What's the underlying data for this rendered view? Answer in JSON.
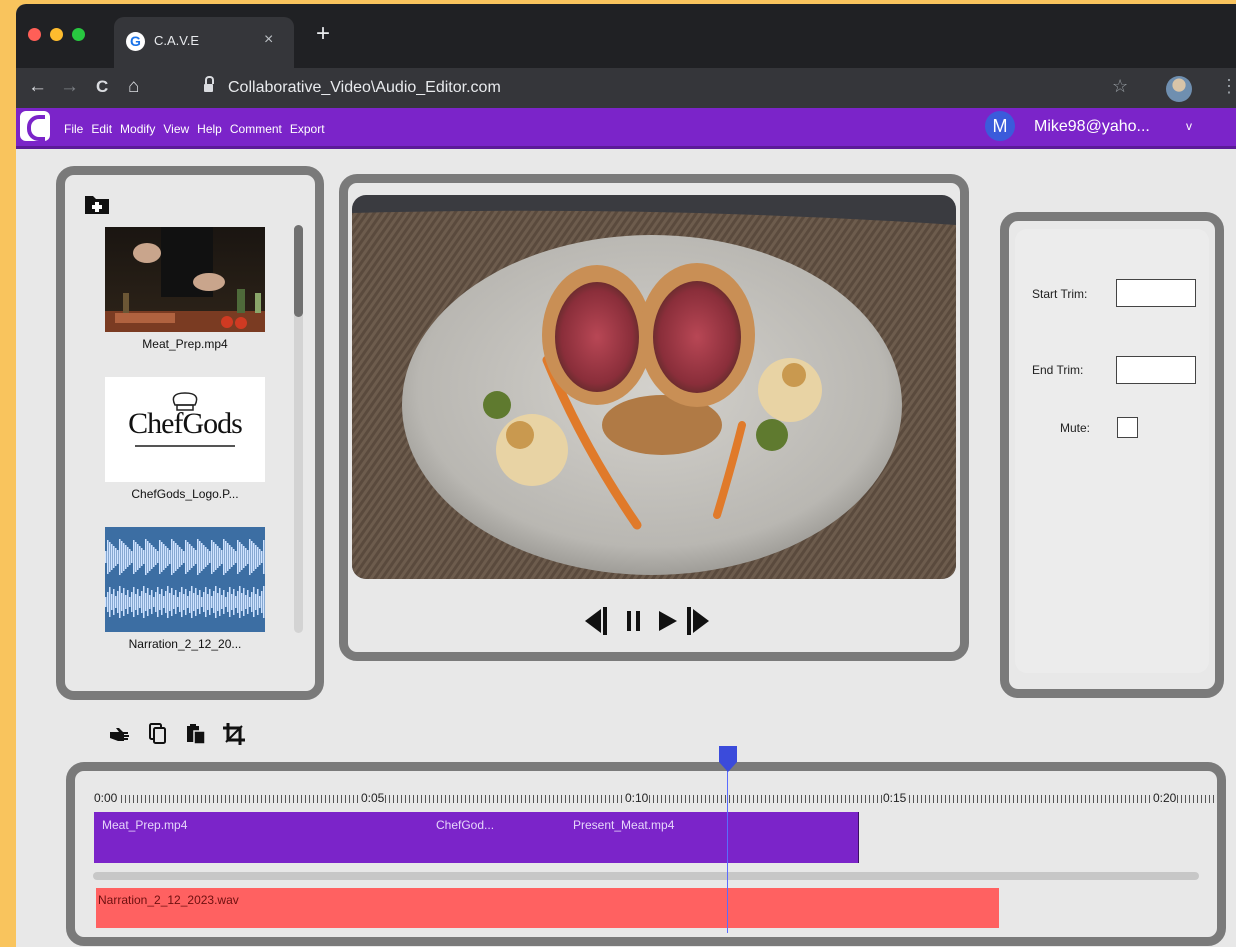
{
  "browser": {
    "tab_title": "C.A.V.E",
    "tab_close": "×",
    "new_tab": "+",
    "url": "Collaborative_Video\\Audio_Editor.com",
    "nav": {
      "back": "←",
      "forward": "→",
      "reload": "C",
      "home": "⌂",
      "star": "☆",
      "menu": "⋮"
    },
    "google_letter": "G"
  },
  "app": {
    "menu": [
      "File",
      "Edit",
      "Modify",
      "View",
      "Help",
      "Comment",
      "Export"
    ],
    "user_initial": "M",
    "user_email": "Mike98@yaho...",
    "user_chevron": "v"
  },
  "media": {
    "items": [
      {
        "label": "Meat_Prep.mp4",
        "kind": "video"
      },
      {
        "label": "ChefGods_Logo.P...",
        "kind": "image"
      },
      {
        "label": "Narration_2_12_20...",
        "kind": "audio"
      }
    ],
    "logo_text": "ChefGods"
  },
  "properties": {
    "start_trim_label": "Start Trim:",
    "start_trim_value": "",
    "end_trim_label": "End Trim:",
    "end_trim_value": "",
    "mute_label": "Mute:",
    "mute_checked": false
  },
  "timeline": {
    "ticks": [
      "0:00",
      "0:05",
      "0:10",
      "0:15",
      "0:20"
    ],
    "video_clips": [
      {
        "label": "Meat_Prep.mp4"
      },
      {
        "label": "ChefGod..."
      },
      {
        "label": "Present_Meat.mp4"
      }
    ],
    "audio_clip": "Narration_2_12_2023.wav"
  },
  "colors": {
    "accent": "#7b24c9",
    "audio_clip": "#ff6161",
    "playhead": "#3b4bdb",
    "panel_border": "#7a7a7a"
  }
}
